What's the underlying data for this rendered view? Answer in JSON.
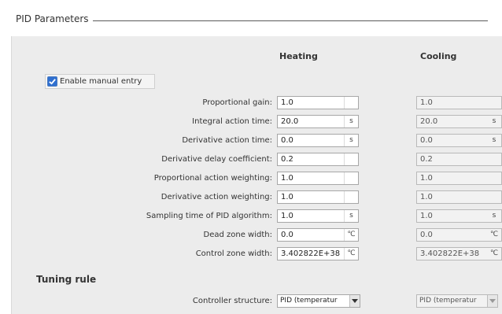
{
  "section": {
    "title": "PID Parameters"
  },
  "columns": {
    "heating": "Heating",
    "cooling": "Cooling"
  },
  "manual_entry": {
    "label": "Enable manual entry",
    "checked": true
  },
  "rows": [
    {
      "label": "Proportional gain:",
      "heat": "1.0",
      "heat_unit": "",
      "cool": "1.0",
      "cool_unit": ""
    },
    {
      "label": "Integral action time:",
      "heat": "20.0",
      "heat_unit": "s",
      "cool": "20.0",
      "cool_unit": "s"
    },
    {
      "label": "Derivative action time:",
      "heat": "0.0",
      "heat_unit": "s",
      "cool": "0.0",
      "cool_unit": "s"
    },
    {
      "label": "Derivative delay coefficient:",
      "heat": "0.2",
      "heat_unit": "",
      "cool": "0.2",
      "cool_unit": ""
    },
    {
      "label": "Proportional action weighting:",
      "heat": "1.0",
      "heat_unit": "",
      "cool": "1.0",
      "cool_unit": ""
    },
    {
      "label": "Derivative action weighting:",
      "heat": "1.0",
      "heat_unit": "",
      "cool": "1.0",
      "cool_unit": ""
    },
    {
      "label": "Sampling time of PID algorithm:",
      "heat": "1.0",
      "heat_unit": "s",
      "cool": "1.0",
      "cool_unit": "s"
    },
    {
      "label": "Dead zone width:",
      "heat": "0.0",
      "heat_unit": "℃",
      "cool": "0.0",
      "cool_unit": "℃"
    },
    {
      "label": "Control zone width:",
      "heat": "3.402822E+38",
      "heat_unit": "℃",
      "cool": "3.402822E+38",
      "cool_unit": "℃"
    }
  ],
  "tuning": {
    "title": "Tuning rule",
    "controller_structure_label": "Controller structure:",
    "heat_value": "PID (temperatur",
    "cool_value": "PID (temperatur"
  },
  "colors": {
    "accent": "#2f6fd0",
    "panel": "#ececec"
  }
}
